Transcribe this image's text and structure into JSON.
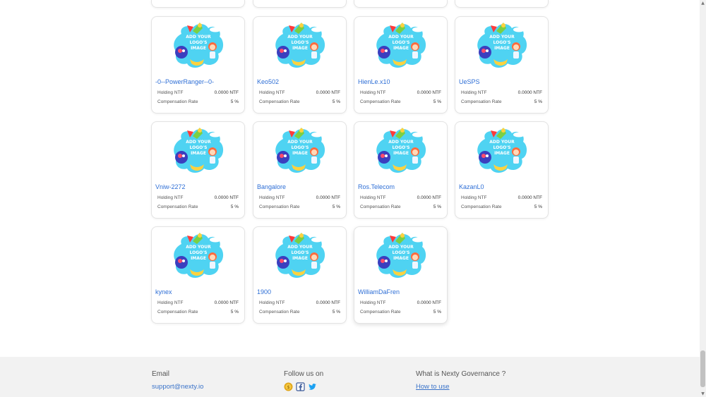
{
  "labels": {
    "holding": "Holding NTF",
    "rate": "Compensation Rate"
  },
  "cards": [
    {
      "name": "-0--PowerRanger--0-",
      "holding": "0.0000 NTF",
      "rate": "5 %"
    },
    {
      "name": "Keo502",
      "holding": "0.0000 NTF",
      "rate": "5 %"
    },
    {
      "name": "HienLe.x10",
      "holding": "0.0000 NTF",
      "rate": "5 %"
    },
    {
      "name": "UeSPS",
      "holding": "0.0000 NTF",
      "rate": "5 %"
    },
    {
      "name": "Vniw-2272",
      "holding": "0.0000 NTF",
      "rate": "5 %"
    },
    {
      "name": "Bangalore",
      "holding": "0.0000 NTF",
      "rate": "5 %"
    },
    {
      "name": "Ros.Telecom",
      "holding": "0.0000 NTF",
      "rate": "5 %"
    },
    {
      "name": "KazanL0",
      "holding": "0.0000 NTF",
      "rate": "5 %"
    },
    {
      "name": "kynex",
      "holding": "0.0000 NTF",
      "rate": "5 %"
    },
    {
      "name": "1900",
      "holding": "0.0000 NTF",
      "rate": "5 %"
    },
    {
      "name": "WilliamDaFren",
      "holding": "0.0000 NTF",
      "rate": "5 %"
    }
  ],
  "placeholder_image": {
    "line1": "ADD YOUR",
    "line2": "LOGO'S",
    "line3": "IMAGE"
  },
  "footer": {
    "email_heading": "Email",
    "email_link": "support@nexty.io",
    "follow_heading": "Follow us on",
    "social_icons": [
      "coin-icon",
      "facebook-icon",
      "twitter-icon"
    ],
    "governance_heading": "What is Nexty Governance ?",
    "how_to_link": "How to use"
  },
  "colors": {
    "accent": "#2f6fd6",
    "blob": "#4fd3f2",
    "footer_bg": "#f2f2f2"
  }
}
